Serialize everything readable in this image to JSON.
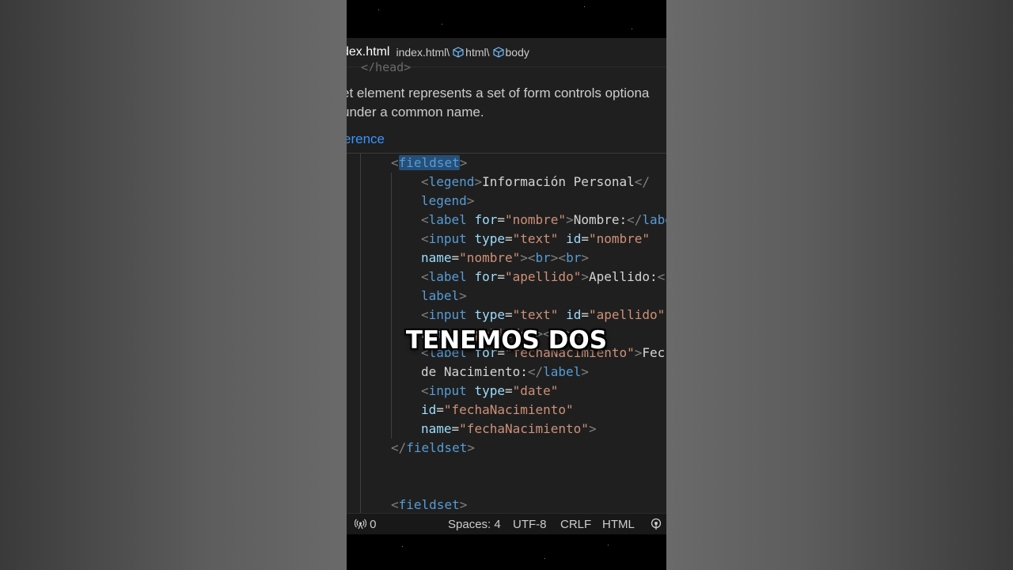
{
  "breadcrumb": {
    "file_tab": "dex.html",
    "path": "index.html\\",
    "items": [
      "html\\",
      "body"
    ]
  },
  "head_ghost": "</head>",
  "hover": {
    "line1": "et element represents a set of form controls optiona",
    "line2": "under a common name.",
    "link": "erence"
  },
  "code": {
    "lines": [
      [
        [
          "t",
          "<"
        ],
        [
          "tag sel",
          "fieldset"
        ],
        [
          "t",
          ">"
        ]
      ],
      [
        [
          "t",
          "<"
        ],
        [
          "tag",
          "legend"
        ],
        [
          "t",
          ">"
        ],
        [
          "txt",
          "Información Personal"
        ],
        [
          "t",
          "</"
        ]
      ],
      [
        [
          "tag",
          "legend"
        ],
        [
          "t",
          ">"
        ]
      ],
      [
        [
          "t",
          "<"
        ],
        [
          "tag",
          "label"
        ],
        [
          "txt",
          " "
        ],
        [
          "attr",
          "for"
        ],
        [
          "txt",
          "="
        ],
        [
          "str",
          "\"nombre\""
        ],
        [
          "t",
          ">"
        ],
        [
          "txt",
          "Nombre:"
        ],
        [
          "t",
          "</"
        ],
        [
          "tag",
          "labe"
        ]
      ],
      [
        [
          "t",
          "<"
        ],
        [
          "tag",
          "input"
        ],
        [
          "txt",
          " "
        ],
        [
          "attr",
          "type"
        ],
        [
          "txt",
          "="
        ],
        [
          "str",
          "\"text\""
        ],
        [
          "txt",
          " "
        ],
        [
          "attr",
          "id"
        ],
        [
          "txt",
          "="
        ],
        [
          "str",
          "\"nombre\""
        ]
      ],
      [
        [
          "attr",
          "name"
        ],
        [
          "txt",
          "="
        ],
        [
          "str",
          "\"nombre\""
        ],
        [
          "t",
          ">"
        ],
        [
          "t",
          "<"
        ],
        [
          "tag",
          "br"
        ],
        [
          "t",
          ">"
        ],
        [
          "t",
          "<"
        ],
        [
          "tag",
          "br"
        ],
        [
          "t",
          ">"
        ]
      ],
      [
        [
          "t",
          "<"
        ],
        [
          "tag",
          "label"
        ],
        [
          "txt",
          " "
        ],
        [
          "attr",
          "for"
        ],
        [
          "txt",
          "="
        ],
        [
          "str",
          "\"apellido\""
        ],
        [
          "t",
          ">"
        ],
        [
          "txt",
          "Apellido:"
        ],
        [
          "t",
          "<"
        ]
      ],
      [
        [
          "tag",
          "label"
        ],
        [
          "t",
          ">"
        ]
      ],
      [
        [
          "t",
          "<"
        ],
        [
          "tag",
          "input"
        ],
        [
          "txt",
          " "
        ],
        [
          "attr",
          "type"
        ],
        [
          "txt",
          "="
        ],
        [
          "str",
          "\"text\""
        ],
        [
          "txt",
          " "
        ],
        [
          "attr",
          "id"
        ],
        [
          "txt",
          "="
        ],
        [
          "str",
          "\"apellido\""
        ]
      ],
      [
        [
          "attr",
          "name"
        ],
        [
          "txt",
          "="
        ],
        [
          "str",
          "\"apellido\""
        ],
        [
          "t",
          ">"
        ],
        [
          "t",
          "<"
        ],
        [
          "tag",
          "br"
        ],
        [
          "t",
          ">"
        ],
        [
          "t",
          "<"
        ],
        [
          "tag",
          "br"
        ],
        [
          "t",
          ">"
        ]
      ],
      [
        [
          "t",
          "<"
        ],
        [
          "tag",
          "label"
        ],
        [
          "txt",
          " "
        ],
        [
          "attr",
          "for"
        ],
        [
          "txt",
          "="
        ],
        [
          "str",
          "\"fechaNacimiento\""
        ],
        [
          "t",
          ">"
        ],
        [
          "txt",
          "Fec"
        ]
      ],
      [
        [
          "txt",
          "de Nacimiento:"
        ],
        [
          "t",
          "</"
        ],
        [
          "tag",
          "label"
        ],
        [
          "t",
          ">"
        ]
      ],
      [
        [
          "t",
          "<"
        ],
        [
          "tag",
          "input"
        ],
        [
          "txt",
          " "
        ],
        [
          "attr",
          "type"
        ],
        [
          "txt",
          "="
        ],
        [
          "str",
          "\"date\""
        ]
      ],
      [
        [
          "attr",
          "id"
        ],
        [
          "txt",
          "="
        ],
        [
          "str",
          "\"fechaNacimiento\""
        ]
      ],
      [
        [
          "attr",
          "name"
        ],
        [
          "txt",
          "="
        ],
        [
          "str",
          "\"fechaNacimiento\""
        ],
        [
          "t",
          ">"
        ]
      ],
      [
        [
          "t",
          "</"
        ],
        [
          "tag",
          "fieldset"
        ],
        [
          "t",
          ">"
        ]
      ],
      [],
      [],
      [
        [
          "t",
          "<"
        ],
        [
          "tag",
          "fieldset"
        ],
        [
          "t",
          ">"
        ]
      ]
    ]
  },
  "status": {
    "ports": "0",
    "spaces": "Spaces: 4",
    "encoding": "UTF-8",
    "eol": "CRLF",
    "language": "HTML"
  },
  "caption": "TENEMOS DOS",
  "colors": {
    "tag": "#569cd6",
    "attr": "#9cdcfe",
    "string": "#ce9178",
    "punct": "#808080",
    "text": "#d4d4d4",
    "link": "#3794ff"
  }
}
